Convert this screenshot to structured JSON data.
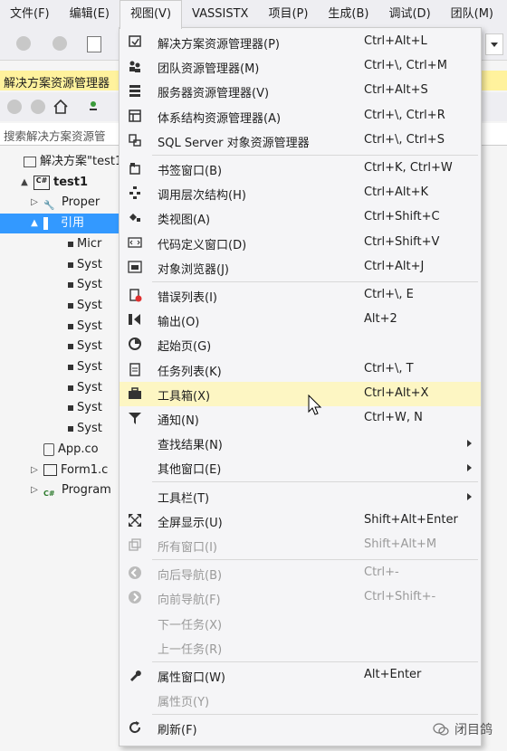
{
  "menubar": {
    "items": [
      "文件(F)",
      "编辑(E)",
      "视图(V)",
      "VASSISTX",
      "项目(P)",
      "生成(B)",
      "调试(D)",
      "团队(M)"
    ],
    "active_index": 2
  },
  "solution_explorer": {
    "title": "解决方案资源管理器",
    "search_placeholder": "搜索解决方案资源管",
    "tree": [
      {
        "label": "解决方案\"test1",
        "icon": "solution-icon",
        "indent": 0,
        "expander": ""
      },
      {
        "label": "test1",
        "icon": "csharp-project-icon",
        "indent": 1,
        "expander": "▲",
        "bold": true
      },
      {
        "label": "Proper",
        "icon": "wrench-icon",
        "indent": 2,
        "expander": "▷"
      },
      {
        "label": "引用",
        "icon": "references-icon",
        "indent": 2,
        "expander": "▲",
        "selected": true
      },
      {
        "label": "Micr",
        "icon": "reference-item-icon",
        "indent": 4,
        "expander": ""
      },
      {
        "label": "Syst",
        "icon": "reference-item-icon",
        "indent": 4,
        "expander": ""
      },
      {
        "label": "Syst",
        "icon": "reference-item-icon",
        "indent": 4,
        "expander": ""
      },
      {
        "label": "Syst",
        "icon": "reference-item-icon",
        "indent": 4,
        "expander": ""
      },
      {
        "label": "Syst",
        "icon": "reference-item-icon",
        "indent": 4,
        "expander": ""
      },
      {
        "label": "Syst",
        "icon": "reference-item-icon",
        "indent": 4,
        "expander": ""
      },
      {
        "label": "Syst",
        "icon": "reference-item-icon",
        "indent": 4,
        "expander": ""
      },
      {
        "label": "Syst",
        "icon": "reference-item-icon",
        "indent": 4,
        "expander": ""
      },
      {
        "label": "Syst",
        "icon": "reference-item-icon",
        "indent": 4,
        "expander": ""
      },
      {
        "label": "Syst",
        "icon": "reference-item-icon",
        "indent": 4,
        "expander": ""
      },
      {
        "label": "App.co",
        "icon": "config-file-icon",
        "indent": 2,
        "expander": ""
      },
      {
        "label": "Form1.c",
        "icon": "form-icon",
        "indent": 2,
        "expander": "▷"
      },
      {
        "label": "Program",
        "icon": "csharp-file-icon",
        "indent": 2,
        "expander": "▷"
      }
    ]
  },
  "view_menu": {
    "items": [
      {
        "label": "解决方案资源管理器(P)",
        "shortcut": "Ctrl+Alt+L",
        "icon": "solution-explorer-icon"
      },
      {
        "label": "团队资源管理器(M)",
        "shortcut": "Ctrl+\\, Ctrl+M",
        "icon": "team-explorer-icon"
      },
      {
        "label": "服务器资源管理器(V)",
        "shortcut": "Ctrl+Alt+S",
        "icon": "server-explorer-icon"
      },
      {
        "label": "体系结构资源管理器(A)",
        "shortcut": "Ctrl+\\, Ctrl+R",
        "icon": "architecture-explorer-icon"
      },
      {
        "label": "SQL Server 对象资源管理器",
        "shortcut": "Ctrl+\\, Ctrl+S",
        "icon": "sql-server-icon",
        "sep_after": true
      },
      {
        "label": "书签窗口(B)",
        "shortcut": "Ctrl+K, Ctrl+W",
        "icon": "bookmark-icon"
      },
      {
        "label": "调用层次结构(H)",
        "shortcut": "Ctrl+Alt+K",
        "icon": "call-hierarchy-icon"
      },
      {
        "label": "类视图(A)",
        "shortcut": "Ctrl+Shift+C",
        "icon": "class-view-icon"
      },
      {
        "label": "代码定义窗口(D)",
        "shortcut": "Ctrl+Shift+V",
        "icon": "code-definition-icon"
      },
      {
        "label": "对象浏览器(J)",
        "shortcut": "Ctrl+Alt+J",
        "icon": "object-browser-icon",
        "sep_after": true
      },
      {
        "label": "错误列表(I)",
        "shortcut": "Ctrl+\\, E",
        "icon": "error-list-icon"
      },
      {
        "label": "输出(O)",
        "shortcut": "Alt+2",
        "icon": "output-icon"
      },
      {
        "label": "起始页(G)",
        "shortcut": "",
        "icon": "start-page-icon"
      },
      {
        "label": "任务列表(K)",
        "shortcut": "Ctrl+\\, T",
        "icon": "task-list-icon"
      },
      {
        "label": "工具箱(X)",
        "shortcut": "Ctrl+Alt+X",
        "icon": "toolbox-icon",
        "highlighted": true
      },
      {
        "label": "通知(N)",
        "shortcut": "Ctrl+W, N",
        "icon": "notification-icon"
      },
      {
        "label": "查找结果(N)",
        "shortcut": "",
        "icon": "",
        "submenu": true
      },
      {
        "label": "其他窗口(E)",
        "shortcut": "",
        "icon": "",
        "submenu": true,
        "sep_after": true
      },
      {
        "label": "工具栏(T)",
        "shortcut": "",
        "icon": "",
        "submenu": true
      },
      {
        "label": "全屏显示(U)",
        "shortcut": "Shift+Alt+Enter",
        "icon": "fullscreen-icon"
      },
      {
        "label": "所有窗口(I)",
        "shortcut": "Shift+Alt+M",
        "icon": "all-windows-icon",
        "disabled": true,
        "sep_after": true
      },
      {
        "label": "向后导航(B)",
        "shortcut": "Ctrl+-",
        "icon": "navigate-back-icon",
        "disabled": true
      },
      {
        "label": "向前导航(F)",
        "shortcut": "Ctrl+Shift+-",
        "icon": "navigate-forward-icon",
        "disabled": true
      },
      {
        "label": "下一任务(X)",
        "shortcut": "",
        "icon": "",
        "disabled": true
      },
      {
        "label": "上一任务(R)",
        "shortcut": "",
        "icon": "",
        "disabled": true,
        "sep_after": true
      },
      {
        "label": "属性窗口(W)",
        "shortcut": "Alt+Enter",
        "icon": "properties-wrench-icon"
      },
      {
        "label": "属性页(Y)",
        "shortcut": "",
        "icon": "",
        "disabled": true,
        "sep_after": true
      },
      {
        "label": "刷新(F)",
        "shortcut": "",
        "icon": "refresh-icon"
      }
    ]
  },
  "watermark": "闭目鸽",
  "colors": {
    "menu_bg": "#f5f5f7",
    "highlight": "#fdf6c3",
    "selected": "#3399ff",
    "title_bar": "#fff29d"
  }
}
